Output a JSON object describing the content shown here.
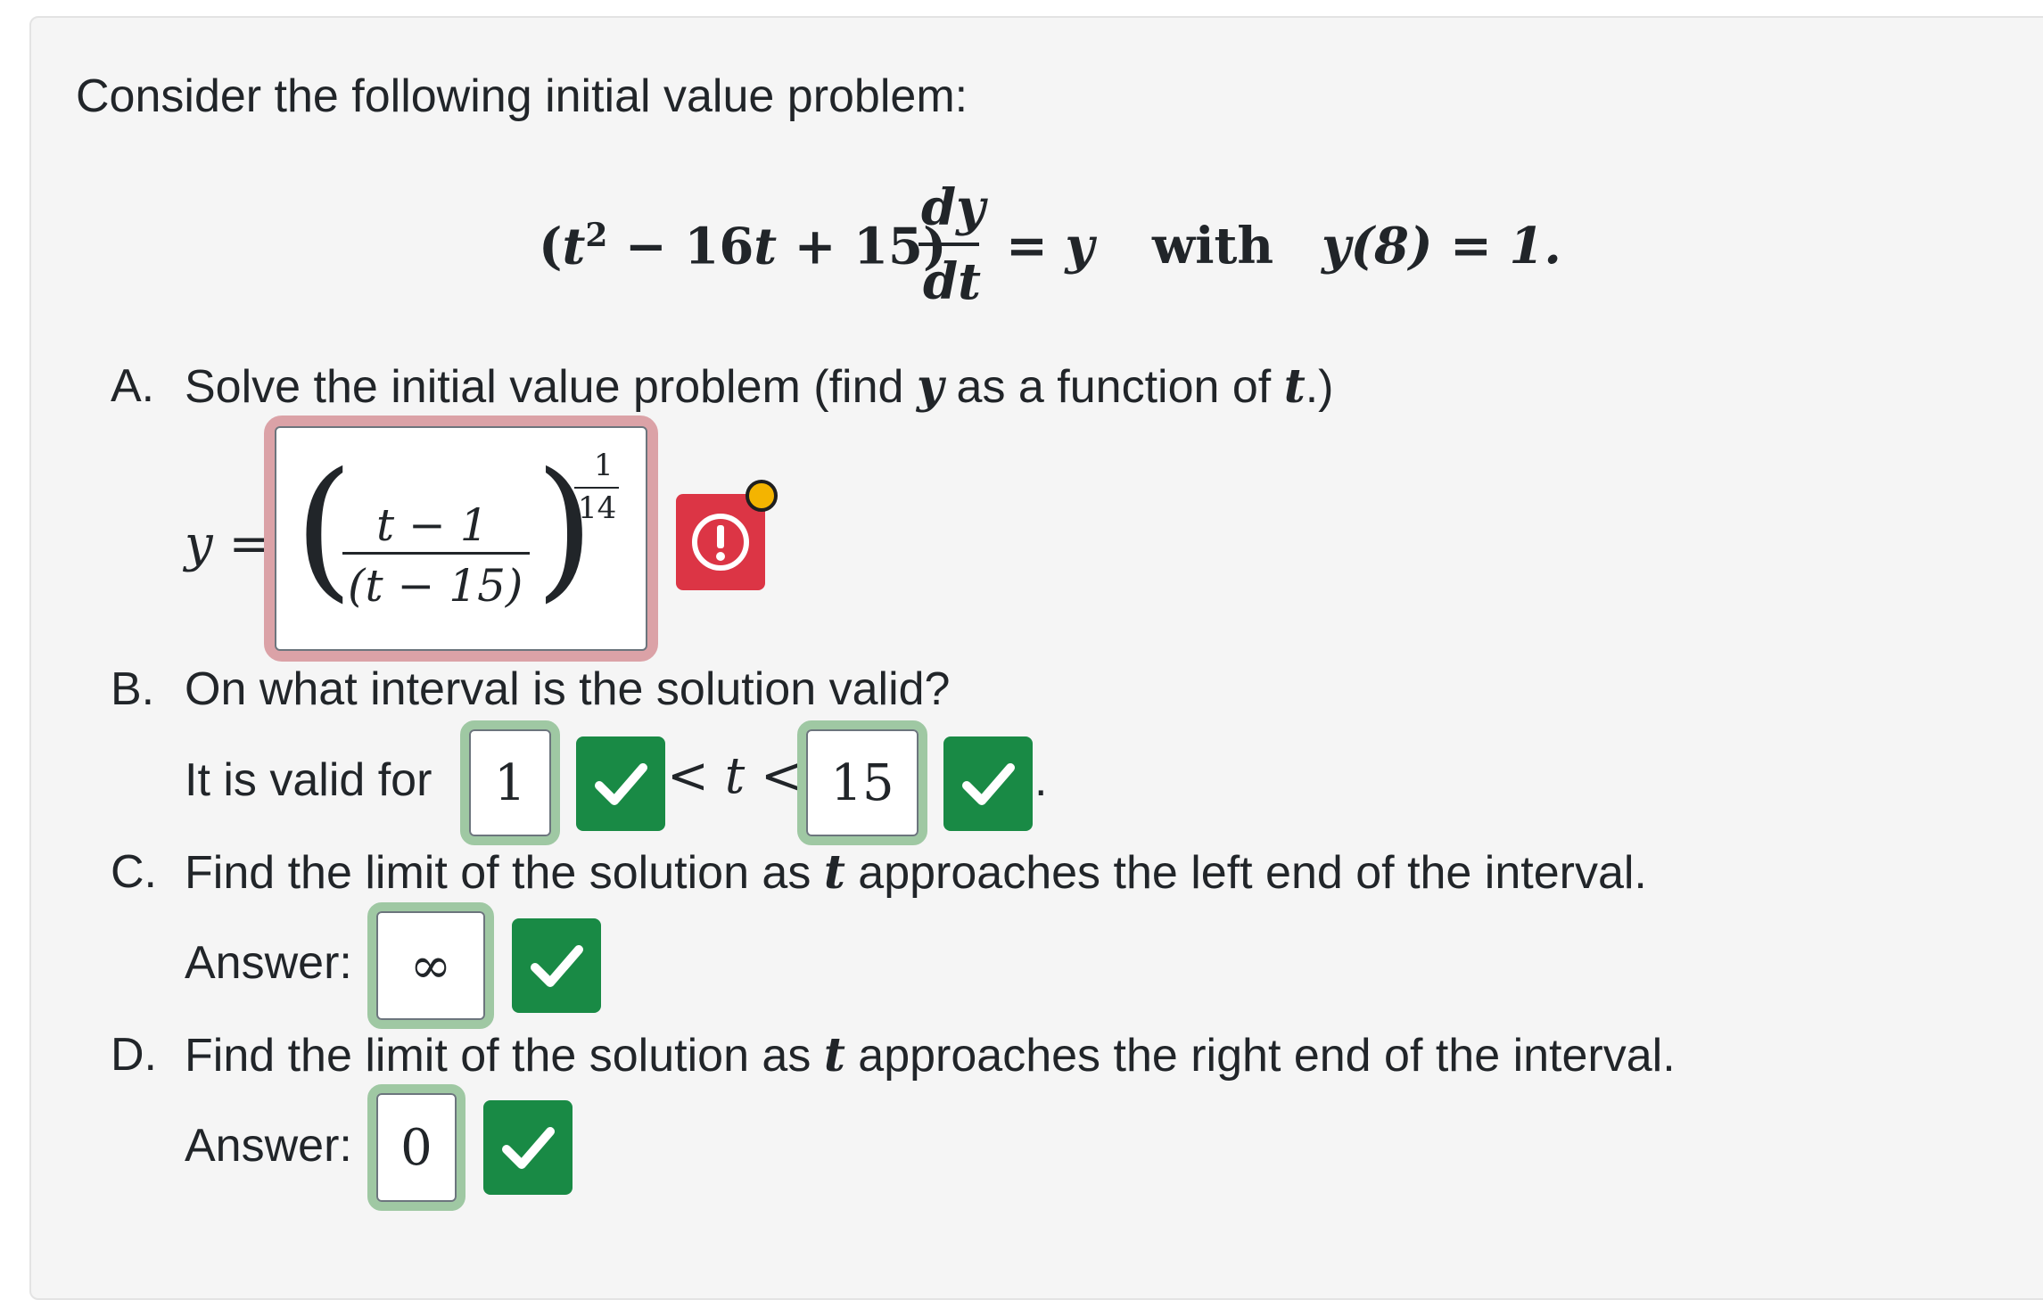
{
  "intro": "Consider the following initial value problem:",
  "equation": {
    "lhs_open": "(",
    "t": "t",
    "exp": "2",
    "rest": " − 16",
    "t2": "t",
    "rest2": " + 15)",
    "numerator": "dy",
    "denominator": "dt",
    "equals": "= ",
    "y": "y",
    "with": "with",
    "ic": "y(8) = 1."
  },
  "partA": {
    "letter": "A.",
    "text_1": "Solve the initial value problem (find ",
    "var_y": "y",
    "text_2": " as a function of ",
    "var_t": "t",
    "text_3": ".)",
    "lhs": "y =",
    "answer": {
      "numerator": "t − 1",
      "denominator": "(t − 15)",
      "exp_num": "1",
      "exp_den": "14"
    },
    "status": "incorrect",
    "status_icon": "alert-circle-icon"
  },
  "partB": {
    "letter": "B.",
    "question": "On what interval is the solution valid?",
    "prefix": "It is valid for",
    "lower_value": "1",
    "mid": "< t <",
    "upper_value": "15",
    "suffix": ".",
    "status": "correct"
  },
  "partC": {
    "letter": "C.",
    "text_1": "Find the limit of the solution as ",
    "var_t": "t",
    "text_2": " approaches the left end of the interval.",
    "answer_label": "Answer:",
    "answer_value": "∞",
    "status": "correct"
  },
  "partD": {
    "letter": "D.",
    "text_1": "Find the limit of the solution as ",
    "var_t": "t",
    "text_2": " approaches the right end of the interval.",
    "answer_label": "Answer:",
    "answer_value": "0",
    "status": "correct"
  },
  "colors": {
    "correct": "#198a45",
    "incorrect": "#dc3545",
    "correct_ring": "#9fc8a3",
    "incorrect_ring": "#dba2a7",
    "pending_dot": "#f4b400"
  }
}
